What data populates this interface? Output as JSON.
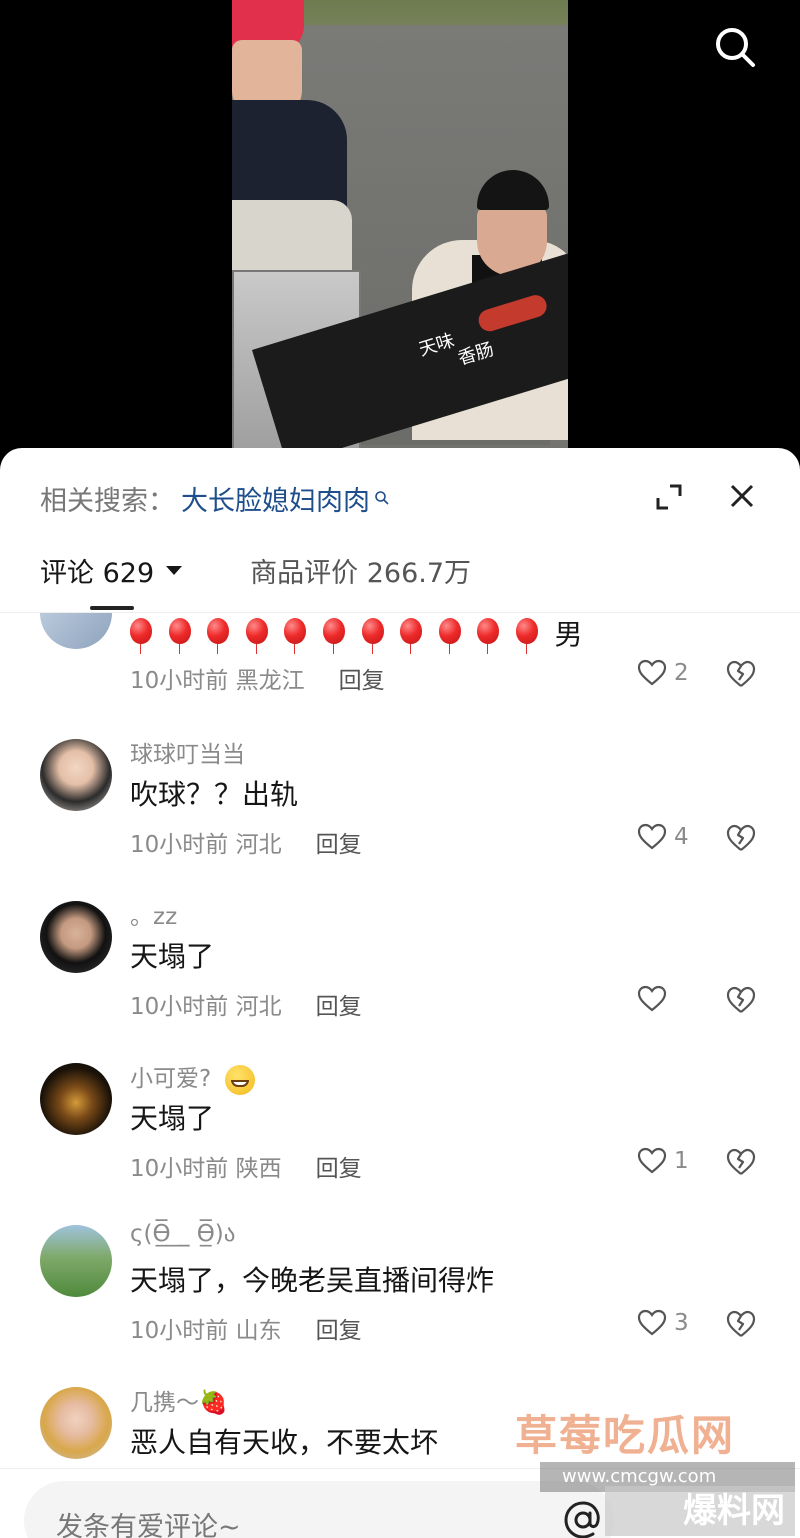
{
  "video": {
    "banner_left_text": "天味",
    "banner_right_text": "香肠"
  },
  "related_search": {
    "prefix": "相关搜索：",
    "query": "大长脸媳妇肉肉"
  },
  "tabs": {
    "comments_label": "评论 629",
    "goods_label": "商品评价 266.7万"
  },
  "comments": [
    {
      "username": "",
      "content_suffix": "男",
      "time": "10小时前",
      "location": "黑龙江",
      "reply": "回复",
      "likes": "2"
    },
    {
      "username": "球球叮当当",
      "content": "吹球？？出轨",
      "time": "10小时前",
      "location": "河北",
      "reply": "回复",
      "likes": "4"
    },
    {
      "username": "。zz",
      "content": "天塌了",
      "time": "10小时前",
      "location": "河北",
      "reply": "回复",
      "likes": ""
    },
    {
      "username": "小可爱?",
      "content": "天塌了",
      "time": "10小时前",
      "location": "陕西",
      "reply": "回复",
      "likes": "1"
    },
    {
      "username": "ς(ϴ̲̅̅ ̲_̲ ϴ̲̅̅)ა",
      "content": "天塌了，今晚老吴直播间得炸",
      "time": "10小时前",
      "location": "山东",
      "reply": "回复",
      "likes": "3"
    },
    {
      "username": "几携～🍓",
      "content": "恶人自有天收，不要太坏",
      "time": "",
      "location": "",
      "reply": "",
      "likes": ""
    }
  ],
  "input": {
    "placeholder": "发条有爱评论~"
  },
  "watermark": {
    "text": "草莓吃瓜网",
    "url": "www.cmcgw.com",
    "badge": "爆料网"
  },
  "colors": {
    "link": "#1f4e8c",
    "muted": "#8a8a8a",
    "text": "#161616"
  }
}
